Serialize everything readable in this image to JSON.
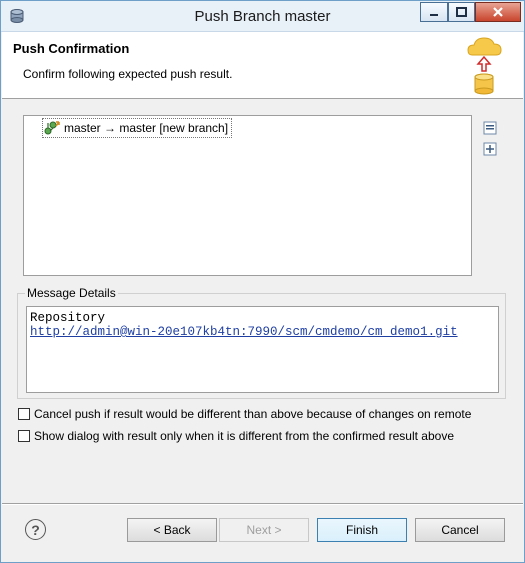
{
  "window": {
    "title": "Push Branch master"
  },
  "header": {
    "title": "Push Confirmation",
    "subtitle": "Confirm following expected push result."
  },
  "tree": {
    "items": [
      {
        "label": "master → master [new branch]"
      }
    ]
  },
  "message_details": {
    "label": "Message Details",
    "line1": "Repository",
    "link": "http://admin@win-20e107kb4tn:7990/scm/cmdemo/cm_demo1.git"
  },
  "options": {
    "cancel_push_label": "Cancel push if result would be different than above because of changes on remote",
    "show_dialog_label": "Show dialog with result only when it is different from the confirmed result above",
    "cancel_push_checked": false,
    "show_dialog_checked": false
  },
  "buttons": {
    "back": "< Back",
    "next": "Next >",
    "finish": "Finish",
    "cancel": "Cancel",
    "help": "?"
  },
  "icons": {
    "app": "git-repo-icon",
    "header": "push-cloud-icon",
    "tree_item": "push-branch-icon",
    "collapse": "collapse-all-icon",
    "expand": "expand-all-icon"
  },
  "colors": {
    "accent_link": "#1f3fa3",
    "close_button": "#c9452d"
  }
}
